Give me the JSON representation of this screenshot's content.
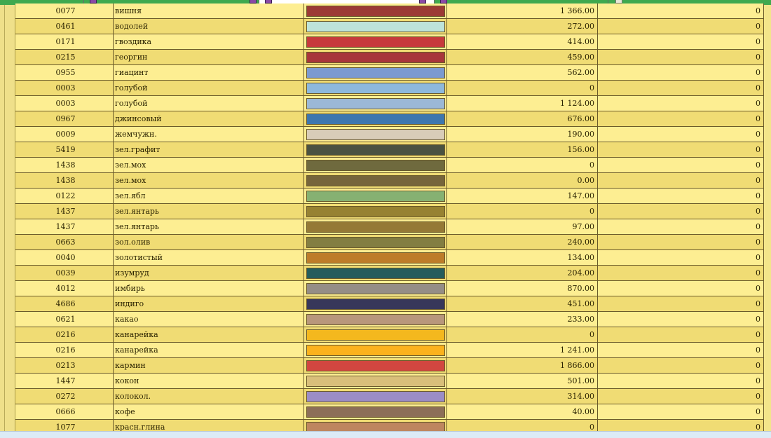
{
  "tabs": [
    {
      "icon": "program-icon"
    },
    {
      "icon": "program-icon"
    },
    {
      "icon": "program-icon"
    },
    {
      "icon": "program-icon"
    },
    {
      "icon": "document-icon"
    }
  ],
  "rows": [
    {
      "code": "0077",
      "name": "вишня",
      "color": "#9c3a35",
      "qty": "1 366.00",
      "zero": "0"
    },
    {
      "code": "0461",
      "name": "водолей",
      "color": "#bde3da",
      "qty": "272.00",
      "zero": "0"
    },
    {
      "code": "0171",
      "name": "гвоздика",
      "color": "#c6393c",
      "qty": "414.00",
      "zero": "0"
    },
    {
      "code": "0215",
      "name": "георгин",
      "color": "#a8363b",
      "qty": "459.00",
      "zero": "0"
    },
    {
      "code": "0955",
      "name": "гиацинт",
      "color": "#7b9ad0",
      "qty": "562.00",
      "zero": "0"
    },
    {
      "code": "0003",
      "name": "голубой",
      "color": "#8db8dc",
      "qty": "0",
      "zero": "0"
    },
    {
      "code": "0003",
      "name": "голубой",
      "color": "#9bb8d6",
      "qty": "1 124.00",
      "zero": "0"
    },
    {
      "code": "0967",
      "name": "джинсовый",
      "color": "#3d76ae",
      "qty": "676.00",
      "zero": "0"
    },
    {
      "code": "0009",
      "name": "жемчужн.",
      "color": "#d8ccb8",
      "qty": "190.00",
      "zero": "0"
    },
    {
      "code": "5419",
      "name": "зел.графит",
      "color": "#4a5241",
      "qty": "156.00",
      "zero": "0"
    },
    {
      "code": "1438",
      "name": "зел.мох",
      "color": "#6f6a3e",
      "qty": "0",
      "zero": "0"
    },
    {
      "code": "1438",
      "name": "зел.мох",
      "color": "#76653b",
      "qty": "0.00",
      "zero": "0"
    },
    {
      "code": "0122",
      "name": "зел.ябл",
      "color": "#86b172",
      "qty": "147.00",
      "zero": "0"
    },
    {
      "code": "1437",
      "name": "зел.янтарь",
      "color": "#978232",
      "qty": "0",
      "zero": "0"
    },
    {
      "code": "1437",
      "name": "зел.янтарь",
      "color": "#957936",
      "qty": "97.00",
      "zero": "0"
    },
    {
      "code": "0663",
      "name": "зол.олив",
      "color": "#837e42",
      "qty": "240.00",
      "zero": "0"
    },
    {
      "code": "0040",
      "name": "золотистый",
      "color": "#bd7c2a",
      "qty": "134.00",
      "zero": "0"
    },
    {
      "code": "0039",
      "name": "изумруд",
      "color": "#255c5c",
      "qty": "204.00",
      "zero": "0"
    },
    {
      "code": "4012",
      "name": "имбирь",
      "color": "#958d86",
      "qty": "870.00",
      "zero": "0"
    },
    {
      "code": "4686",
      "name": "индиго",
      "color": "#37375a",
      "qty": "451.00",
      "zero": "0"
    },
    {
      "code": "0621",
      "name": "какао",
      "color": "#b8977c",
      "qty": "233.00",
      "zero": "0"
    },
    {
      "code": "0216",
      "name": "канарейка",
      "color": "#f4b81e",
      "qty": "0",
      "zero": "0"
    },
    {
      "code": "0216",
      "name": "канарейка",
      "color": "#fbb21d",
      "qty": "1 241.00",
      "zero": "0"
    },
    {
      "code": "0213",
      "name": "кармин",
      "color": "#d24640",
      "qty": "1 866.00",
      "zero": "0"
    },
    {
      "code": "1447",
      "name": "кокон",
      "color": "#d9bf7a",
      "qty": "501.00",
      "zero": "0"
    },
    {
      "code": "0272",
      "name": "колокол.",
      "color": "#9b8dc6",
      "qty": "314.00",
      "zero": "0"
    },
    {
      "code": "0666",
      "name": "кофе",
      "color": "#8c6e58",
      "qty": "40.00",
      "zero": "0"
    },
    {
      "code": "1077",
      "name": "красн.глина",
      "color": "#be865f",
      "qty": "0",
      "zero": "0"
    }
  ]
}
